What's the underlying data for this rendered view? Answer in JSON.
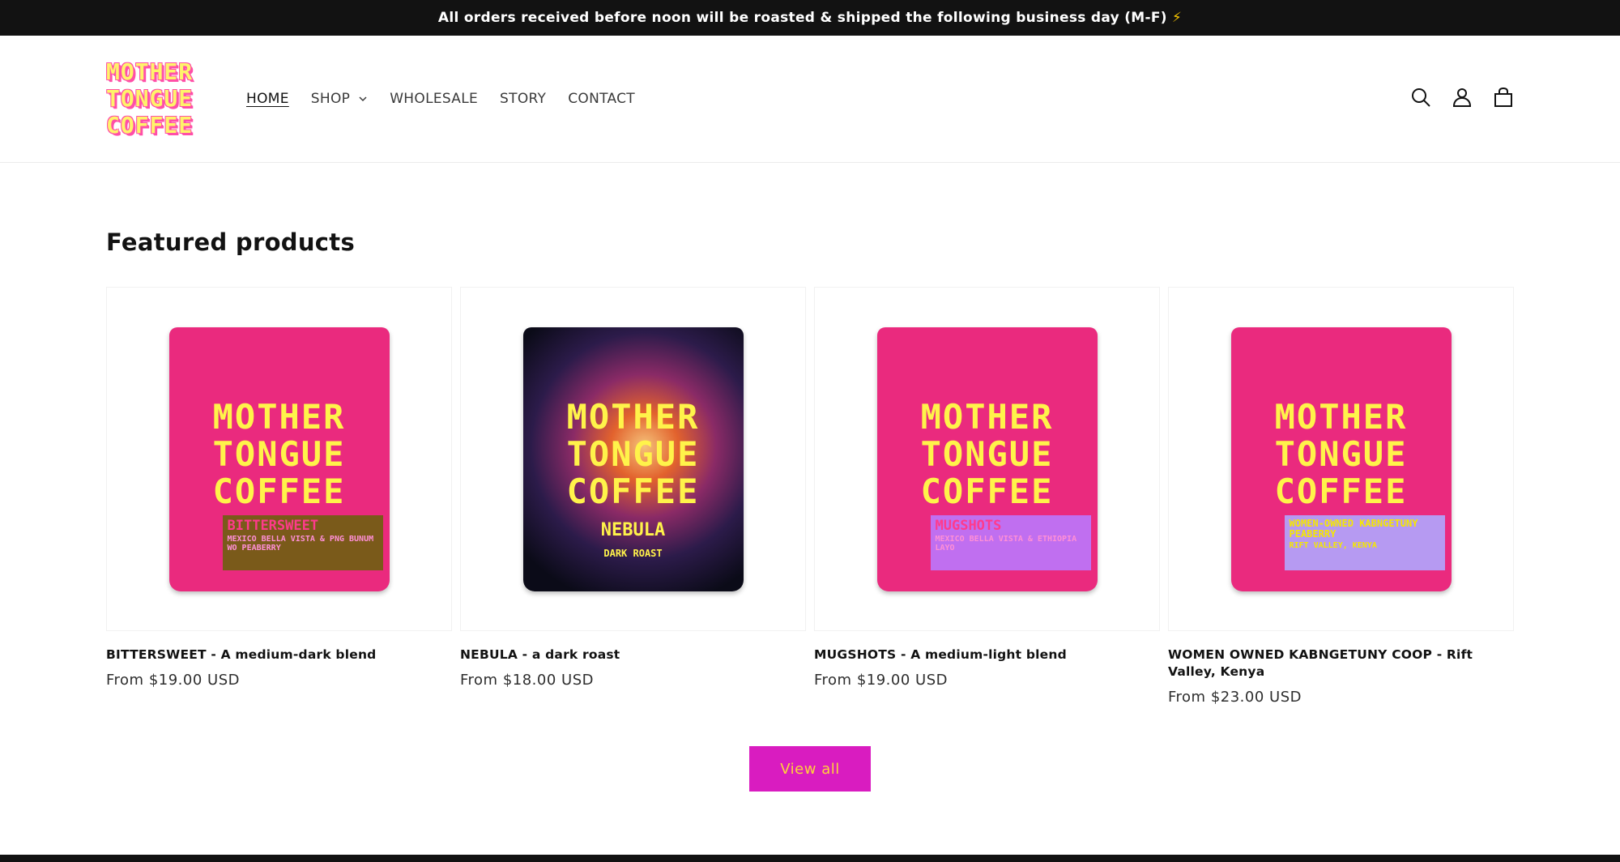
{
  "announcement": {
    "text": "All orders received before noon will be roasted & shipped the following business day (M-F)",
    "emoji": "⚡"
  },
  "header": {
    "logo_lines": [
      "MOTHER",
      "TONGUE",
      "COFFEE"
    ],
    "nav": [
      {
        "label": "HOME",
        "active": true
      },
      {
        "label": "SHOP",
        "dropdown": true
      },
      {
        "label": "WHOLESALE"
      },
      {
        "label": "STORY"
      },
      {
        "label": "CONTACT"
      }
    ],
    "icons": [
      "search-icon",
      "account-icon",
      "cart-icon"
    ]
  },
  "section": {
    "title": "Featured products",
    "view_all_label": "View all"
  },
  "products": [
    {
      "title": "BITTERSWEET - A medium-dark blend",
      "price": "From $19.00 USD",
      "bag": {
        "style": "pink",
        "brand": [
          "MOTHER",
          "TONGUE",
          "COFFEE"
        ],
        "label_title": "BITTERSWEET",
        "label_sub": "MEXICO BELLA VISTA & PNG BUNUM WO PEABERRY",
        "label_bg": "#f07ad0",
        "label_color": "#ff3a8c"
      }
    },
    {
      "title": "NEBULA - a dark roast",
      "price": "From $18.00 USD",
      "bag": {
        "style": "space",
        "brand": [
          "MOTHER",
          "TONGUE",
          "COFFEE"
        ],
        "name": "NEBULA",
        "roast": "DARK ROAST"
      }
    },
    {
      "title": "MUGSHOTS - A medium-light blend",
      "price": "From $19.00 USD",
      "bag": {
        "style": "pink",
        "brand": [
          "MOTHER",
          "TONGUE",
          "COFFEE"
        ],
        "label_title": "MUGSHOTS",
        "label_sub": "MEXICO BELLA VISTA & ETHIOPIA LAYO",
        "label_bg": "#7af0b0",
        "label_color": "#ff3a8c"
      }
    },
    {
      "title": "WOMEN OWNED KABNGETUNY COOP - Rift Valley, Kenya",
      "price": "From $23.00 USD",
      "bag": {
        "style": "pink",
        "brand": [
          "MOTHER",
          "TONGUE",
          "COFFEE"
        ],
        "label_title": "WOMEN-OWNED KABNGETUNY PEABERRY",
        "label_sub": "RIFT VALLEY, KENYA",
        "label_bg": "#b69af2",
        "label_color": "#f5e800"
      }
    }
  ],
  "colors": {
    "announcement_bg": "#121212",
    "accent_button": "#d91cc0",
    "button_text": "#ffd23a",
    "bag_pink": "#ea2a7e",
    "logo_yellow": "#fff36a"
  }
}
